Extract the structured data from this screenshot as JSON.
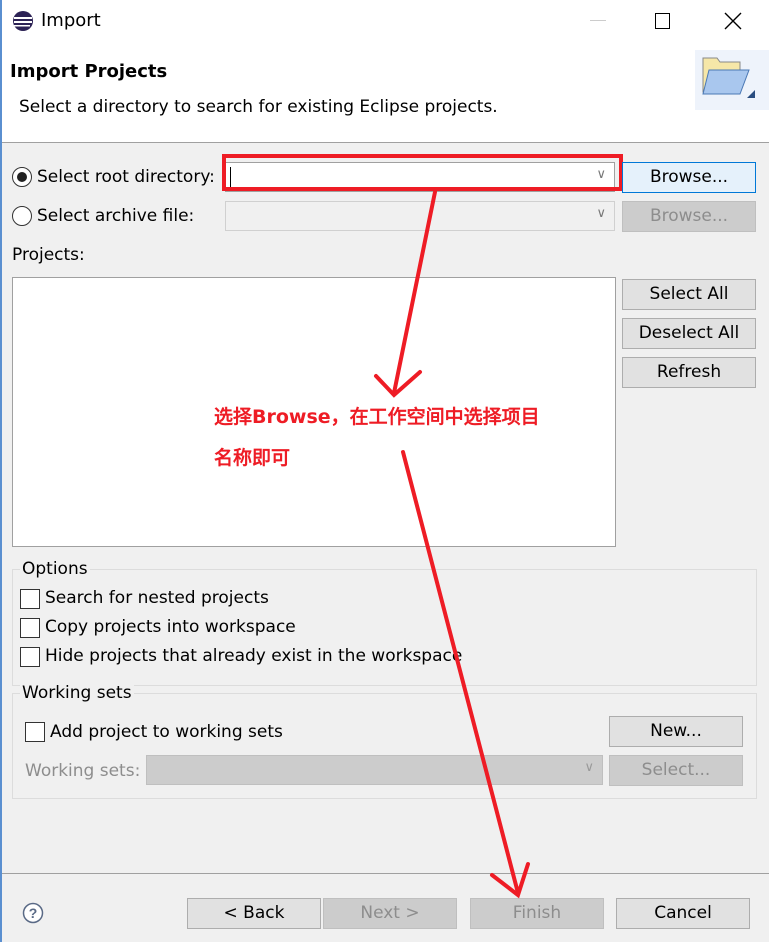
{
  "window": {
    "title": "Import",
    "minimize_icon": "minimize-icon",
    "maximize_icon": "maximize-icon",
    "close_icon": "close-icon"
  },
  "header": {
    "title": "Import Projects",
    "description": "Select a directory to search for existing Eclipse projects."
  },
  "source": {
    "root_label": "Select root directory:",
    "root_value": "",
    "root_selected": true,
    "archive_label": "Select archive file:",
    "archive_value": "",
    "browse_label": "Browse...",
    "browse_disabled_label": "Browse..."
  },
  "projects": {
    "label": "Projects:",
    "items": [],
    "select_all": "Select All",
    "deselect_all": "Deselect All",
    "refresh": "Refresh"
  },
  "options": {
    "title": "Options",
    "items": [
      {
        "label": "Search for nested projects",
        "checked": false
      },
      {
        "label": "Copy projects into workspace",
        "checked": false
      },
      {
        "label": "Hide projects that already exist in the workspace",
        "checked": false
      }
    ]
  },
  "working_sets": {
    "title": "Working sets",
    "add_label": "Add project to working sets",
    "add_checked": false,
    "new_label": "New...",
    "sets_label": "Working sets:",
    "select_label": "Select..."
  },
  "footer": {
    "help_icon": "help-icon",
    "back": "< Back",
    "next": "Next >",
    "finish": "Finish",
    "cancel": "Cancel"
  },
  "annotation": {
    "line1": "选择Browse，在工作空间中选择项目",
    "line2": "名称即可",
    "color": "#ee1c25"
  }
}
